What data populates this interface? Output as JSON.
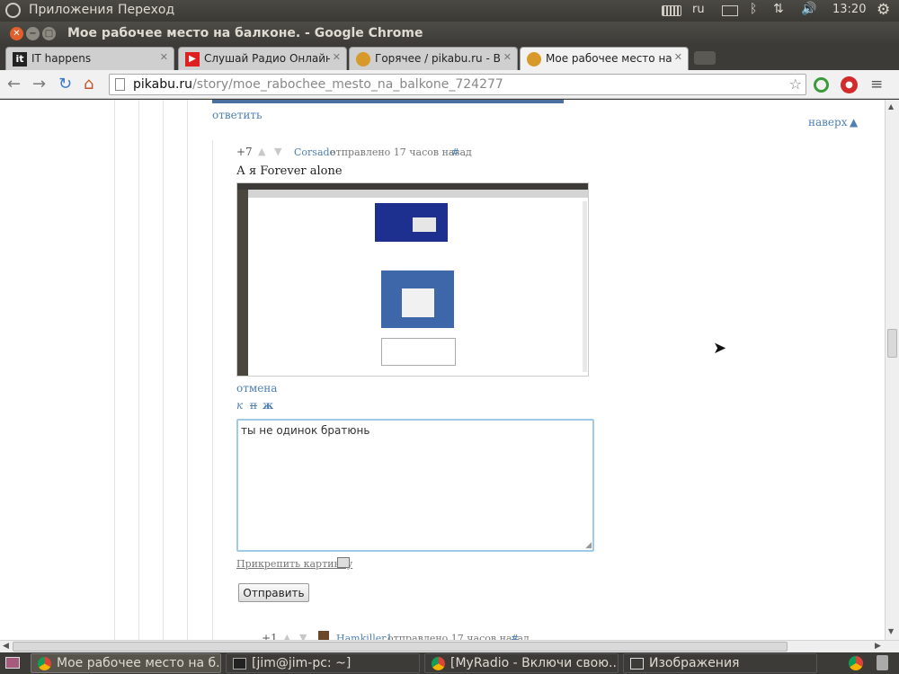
{
  "panel": {
    "apps_label": "Приложения",
    "places_label": "Переход",
    "keyboard_layout": "ru",
    "time": "13:20"
  },
  "window": {
    "title": "Мое рабочее место на балконе. - Google Chrome"
  },
  "tabs": [
    {
      "label": "IT happens",
      "active": false
    },
    {
      "label": "Слушай Радио Онлайн на",
      "active": false
    },
    {
      "label": "Горячее / pikabu.ru - Все",
      "active": false
    },
    {
      "label": "Мое рабочее место на ба",
      "active": true
    }
  ],
  "toolbar": {
    "url_host": "pikabu.ru",
    "url_path": "/story/moe_rabochee_mesto_na_balkone_724277"
  },
  "page": {
    "reply_link": "ответить",
    "top_link": "наверх",
    "comment": {
      "rating": "+7",
      "author": "Corsade",
      "meta": "отправлено 17 часов назад",
      "hash": "#",
      "text": "А я Forever alone"
    },
    "cancel_link": "отмена",
    "format": {
      "italic": "к",
      "strike": "п",
      "bold": "ж"
    },
    "reply_text": "ты не одинок братюнь",
    "attach_label": "Прикрепить картинку",
    "submit_label": "Отправить",
    "next_comment": {
      "rating": "+1",
      "author": "Hamkiller1",
      "meta": "отправлено 17 часов назад",
      "hash": "#"
    }
  },
  "taskbar": [
    {
      "label": "Мое рабочее место на б...",
      "active": true
    },
    {
      "label": "[jim@jim-pc: ~]",
      "active": false
    },
    {
      "label": "[MyRadio - Включи свою...",
      "active": false
    },
    {
      "label": "Изображения",
      "active": false
    }
  ],
  "colors": {
    "link": "#4f7fb3",
    "panel": "#3c3b37",
    "focus_border": "#9ecbe8"
  }
}
